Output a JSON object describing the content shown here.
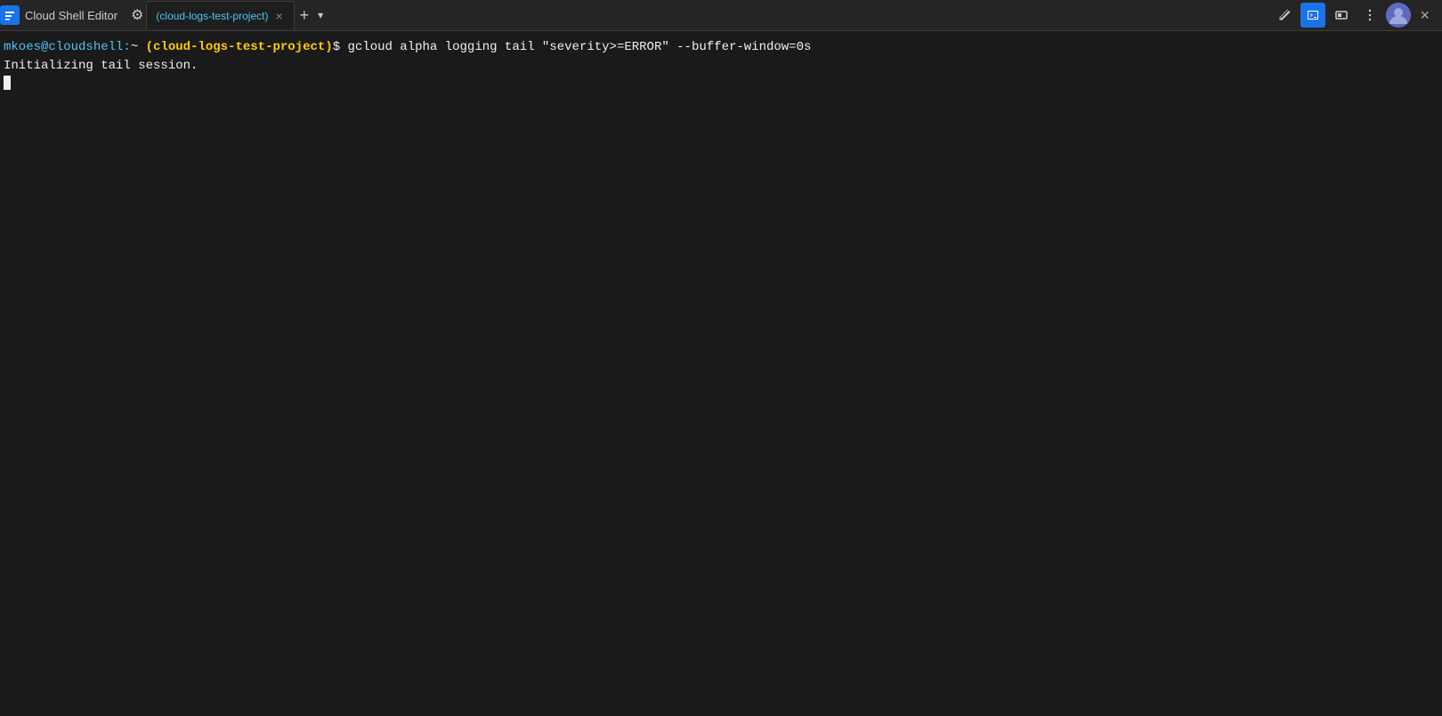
{
  "header": {
    "app_title": "Cloud Shell Editor",
    "tab_label": "(cloud-logs-test-project)",
    "tab_close_label": "×",
    "tab_add_label": "+",
    "tab_dropdown_label": "▾"
  },
  "toolbar": {
    "pencil_label": "✏",
    "terminal_icon_label": ">_",
    "preview_icon_label": "⬜",
    "more_icon_label": "⋮",
    "close_label": "×"
  },
  "terminal": {
    "prompt_user": "mkoes@cloudshell:",
    "prompt_tilde": "~",
    "prompt_project": "(cloud-logs-test-project)",
    "prompt_dollar": "$",
    "command": " gcloud alpha logging tail \"severity>=ERROR\" --buffer-window=0s",
    "output_line1": "Initializing tail session."
  }
}
